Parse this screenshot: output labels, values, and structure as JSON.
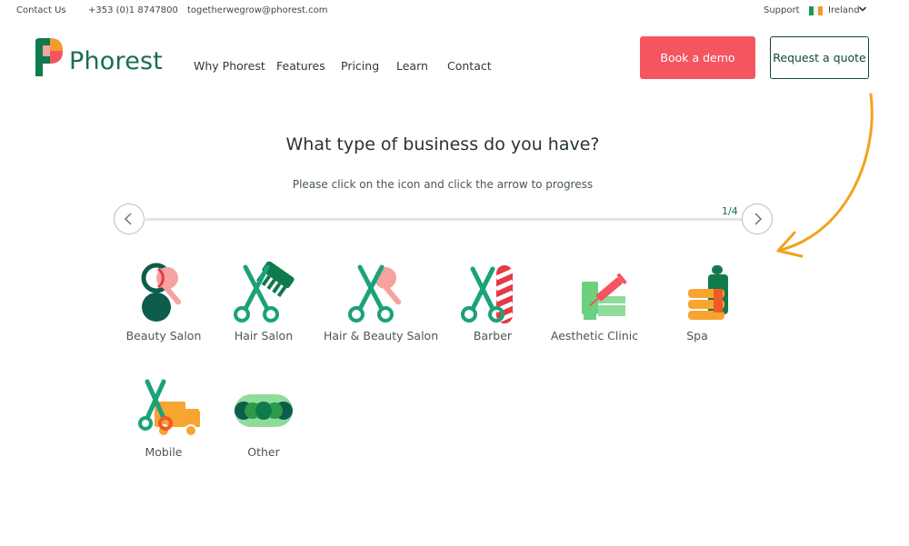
{
  "topbar": {
    "contact_label": "Contact Us",
    "phone": "+353 (0)1 8747800",
    "email": "togetherwegrow@phorest.com",
    "support_label": "Support",
    "country": "Ireland"
  },
  "brand": {
    "name": "Phorest",
    "color": "#15704a"
  },
  "nav": {
    "items": [
      {
        "label": "Why Phorest"
      },
      {
        "label": "Features"
      },
      {
        "label": "Pricing"
      },
      {
        "label": "Learn"
      },
      {
        "label": "Contact"
      }
    ]
  },
  "cta": {
    "demo_label": "Book a demo",
    "quote_label": "Request a quote",
    "demo_color": "#f4555f"
  },
  "wizard": {
    "title": "What type of business do you have?",
    "instruction": "Please click on the icon and click the arrow to progress",
    "step": "1/4",
    "progress": 0.0
  },
  "business_types": [
    {
      "label": "Beauty Salon",
      "icon": "mirror-brush-icon"
    },
    {
      "label": "Hair Salon",
      "icon": "scissors-comb-icon"
    },
    {
      "label": "Hair & Beauty Salon",
      "icon": "scissors-brush-icon"
    },
    {
      "label": "Barber",
      "icon": "scissors-barber-pole-icon"
    },
    {
      "label": "Aesthetic Clinic",
      "icon": "syringe-cream-icon"
    },
    {
      "label": "Spa",
      "icon": "towel-bottle-icon"
    },
    {
      "label": "Mobile",
      "icon": "scissors-van-icon"
    },
    {
      "label": "Other",
      "icon": "dots-icon"
    }
  ]
}
